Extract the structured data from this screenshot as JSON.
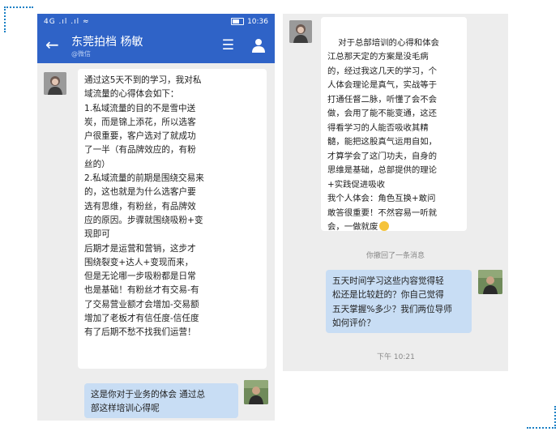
{
  "status_bar": {
    "signal_text": "4G .ıl .ıl ≈",
    "time": "10:36"
  },
  "chat": {
    "title": "东莞拍档 杨敏",
    "subtitle": "@微信"
  },
  "left_messages": [
    {
      "side": "received",
      "text": "通过这5天不到的学习，我对私\n域流量的心得体会如下：\n1.私域流量的目的不是雪中送\n炭，而是锦上添花，所以选客\n户很重要，客户选对了就成功\n了一半（有品牌效应的，有粉\n丝的）\n2.私域流量的前期是围绕交易来\n的，这也就是为什么选客户要\n选有思维，有粉丝，有品牌效\n应的原因。步骤就围绕吸粉+变\n现即可\n后期才是运营和营销，这步才\n围绕裂变+达人+变现而来，\n但是无论哪一步吸粉都是日常\n也是基础！有粉丝才有交易-有\n了交易营业额才会增加-交易额\n增加了老板才有信任度-信任度\n有了后期不愁不找我们运营！"
    },
    {
      "side": "sent",
      "text": "这是你对于业务的体会 通过总\n部这样培训心得呢"
    }
  ],
  "right_messages": [
    {
      "side": "received",
      "text": "对于总部培训的心得和体会\n江总那天定的方案是没毛病\n的，经过我这几天的学习，个\n人体会理论是真气，实战等于\n打通任督二脉，听懂了会不会\n做，会用了能不能变通，这还\n得看学习的人能否吸收其精\n髓，能把这股真气运用自如，\n才算学会了这门功夫，自身的\n思维是基础，总部提供的理论\n+实践促进吸收\n我个人体会：角色互换+敢问\n敢答很重要！不然容易一听就\n会，一做就废"
    },
    {
      "side": "sent",
      "text": "五天时间学习这些内容觉得轻\n松还是比较赶的？你自己觉得\n五天掌握%多少？我们两位导师\n如何评价？"
    }
  ],
  "right_notice": "你撤回了一条消息",
  "right_time": "下午 10:21",
  "icons": {
    "back": "back-arrow-icon",
    "menu": "menu-icon",
    "contact": "contact-icon",
    "emoji": "grin-emoji-icon"
  },
  "colors": {
    "header_blue": "#2f63c7",
    "sent_bubble": "#c8ddf4",
    "chat_bg": "#ededed",
    "accent_dotted": "#1a7fc4"
  }
}
